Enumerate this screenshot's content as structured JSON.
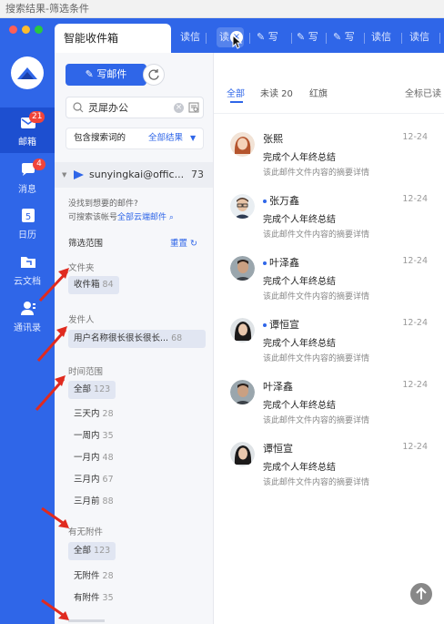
{
  "window": {
    "title": "搜索结果-筛选条件"
  },
  "colors": {
    "accent": "#2f66e8",
    "badge": "#f0443a",
    "selected_chip": "#e1e6f2",
    "annotation_arrow": "#e02a1f"
  },
  "sidebar": {
    "items": [
      {
        "label": "邮箱",
        "icon": "mail-icon",
        "badge": "21"
      },
      {
        "label": "消息",
        "icon": "chat-icon",
        "badge": "4"
      },
      {
        "label": "日历",
        "icon": "calendar-icon",
        "day": "5"
      },
      {
        "label": "云文档",
        "icon": "folder-icon"
      },
      {
        "label": "通讯录",
        "icon": "contacts-icon"
      }
    ]
  },
  "tabs": {
    "active": "智能收件箱",
    "items": [
      "读信",
      "读",
      "写",
      "写",
      "写",
      "读信",
      "读信"
    ]
  },
  "toolbar": {
    "compose": "写邮件"
  },
  "search": {
    "value": "灵犀办公"
  },
  "filter": {
    "scope_label": "包含搜索词的",
    "scope_value": "全部结果"
  },
  "account": {
    "email": "sunyingkai@offic...",
    "count": "73"
  },
  "hint": {
    "line1": "没找到想要的邮件?",
    "line2": "可搜索该帐号",
    "link": "全部云端邮件"
  },
  "range": {
    "title": "筛选范围",
    "reset": "重置"
  },
  "folder": {
    "title": "文件夹",
    "chip_label": "收件箱",
    "chip_count": "84"
  },
  "sender_filter": {
    "title": "发件人",
    "chip_label": "用户名称很长很长很长...",
    "chip_count": "68"
  },
  "time": {
    "title": "时间范围",
    "options": [
      {
        "label": "全部",
        "count": "123"
      },
      {
        "label": "三天内",
        "count": "28"
      },
      {
        "label": "一周内",
        "count": "35"
      },
      {
        "label": "一月内",
        "count": "48"
      },
      {
        "label": "三月内",
        "count": "67"
      },
      {
        "label": "三月前",
        "count": "88"
      }
    ]
  },
  "attachment": {
    "title": "有无附件",
    "options": [
      {
        "label": "全部",
        "count": "123"
      },
      {
        "label": "无附件",
        "count": "28"
      },
      {
        "label": "有附件",
        "count": "35"
      }
    ]
  },
  "list_tabs": {
    "all": "全部",
    "unread": "未读 20",
    "flag": "红旗",
    "mark_all": "全标已读"
  },
  "mails": [
    {
      "sender": "张熙",
      "unread": false,
      "date": "12-24",
      "subject": "完成个人年终总结",
      "summary": "该此邮件文件内容的摘要详情",
      "avatar": "woman-red"
    },
    {
      "sender": "张万鑫",
      "unread": true,
      "date": "12-24",
      "subject": "完成个人年终总结",
      "summary": "该此邮件文件内容的摘要详情",
      "avatar": "man-glasses"
    },
    {
      "sender": "叶泽鑫",
      "unread": true,
      "date": "12-24",
      "subject": "完成个人年终总结",
      "summary": "该此邮件文件内容的摘要详情",
      "avatar": "man-dark"
    },
    {
      "sender": "谭恒宣",
      "unread": true,
      "date": "12-24",
      "subject": "完成个人年终总结",
      "summary": "该此邮件文件内容的摘要详情",
      "avatar": "woman-dark"
    },
    {
      "sender": "叶泽鑫",
      "unread": false,
      "date": "12-24",
      "subject": "完成个人年终总结",
      "summary": "该此邮件文件内容的摘要详情",
      "avatar": "man-dark"
    },
    {
      "sender": "谭恒宣",
      "unread": false,
      "date": "12-24",
      "subject": "完成个人年终总结",
      "summary": "该此邮件文件内容的摘要详情",
      "avatar": "woman-dark"
    }
  ]
}
